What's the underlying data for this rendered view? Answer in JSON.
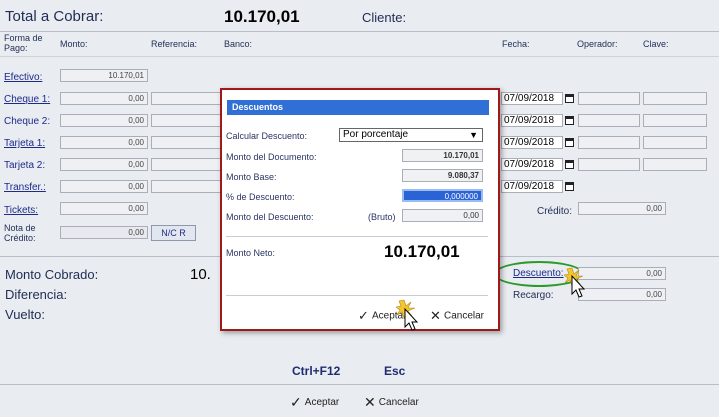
{
  "header": {
    "total_label": "Total a Cobrar:",
    "total_value": "10.170,01",
    "client_label": "Cliente:"
  },
  "columns": {
    "forma_pago": "Forma de Pago:",
    "monto": "Monto:",
    "referencia": "Referencia:",
    "banco": "Banco:",
    "fecha": "Fecha:",
    "operador": "Operador:",
    "clave": "Clave:"
  },
  "rows": {
    "efectivo": {
      "label": "Efectivo:",
      "amount": "10.170,01"
    },
    "cheque1": {
      "label": "Cheque 1:",
      "amount": "0,00",
      "date": "07/09/2018"
    },
    "cheque2": {
      "label": "Cheque 2:",
      "amount": "0,00",
      "date": "07/09/2018"
    },
    "tarjeta1": {
      "label": "Tarjeta 1:",
      "amount": "0,00",
      "date": "07/09/2018"
    },
    "tarjeta2": {
      "label": "Tarjeta 2:",
      "amount": "0,00",
      "date": "07/09/2018"
    },
    "transfer": {
      "label": "Transfer.:",
      "amount": "0,00",
      "date": "07/09/2018"
    },
    "tickets": {
      "label": "Tickets:",
      "amount": "0,00"
    },
    "nota_credito": {
      "label": "Nota de Crédito:",
      "amount": "0,00",
      "button": "N/C R"
    }
  },
  "credito": {
    "label": "Crédito:",
    "amount": "0,00"
  },
  "summary": {
    "monto_cobrado_label": "Monto Cobrado:",
    "monto_cobrado_value": "10.",
    "diferencia_label": "Diferencia:",
    "vuelto_label": "Vuelto:",
    "descuento_label": "Descuento:",
    "descuento_value": "0,00",
    "recargo_label": "Recargo:",
    "recargo_value": "0,00"
  },
  "shortcuts": {
    "ctrl_f12": "Ctrl+F12",
    "esc": "Esc"
  },
  "footer": {
    "accept": "Aceptar",
    "cancel": "Cancelar"
  },
  "modal": {
    "title": "Descuentos",
    "calc_label": "Calcular Descuento:",
    "calc_value": "Por porcentaje",
    "monto_documento_label": "Monto del Documento:",
    "monto_documento_value": "10.170,01",
    "monto_base_label": "Monto Base:",
    "monto_base_value": "9.080,37",
    "porcentaje_label": "% de Descuento:",
    "porcentaje_value": "0,000000",
    "monto_descuento_label": "Monto del Descuento:",
    "bruto_label": "(Bruto)",
    "monto_descuento_value": "0,00",
    "monto_neto_label": "Monto Neto:",
    "monto_neto_value": "10.170,01",
    "accept": "Aceptar",
    "cancel": "Cancelar"
  }
}
